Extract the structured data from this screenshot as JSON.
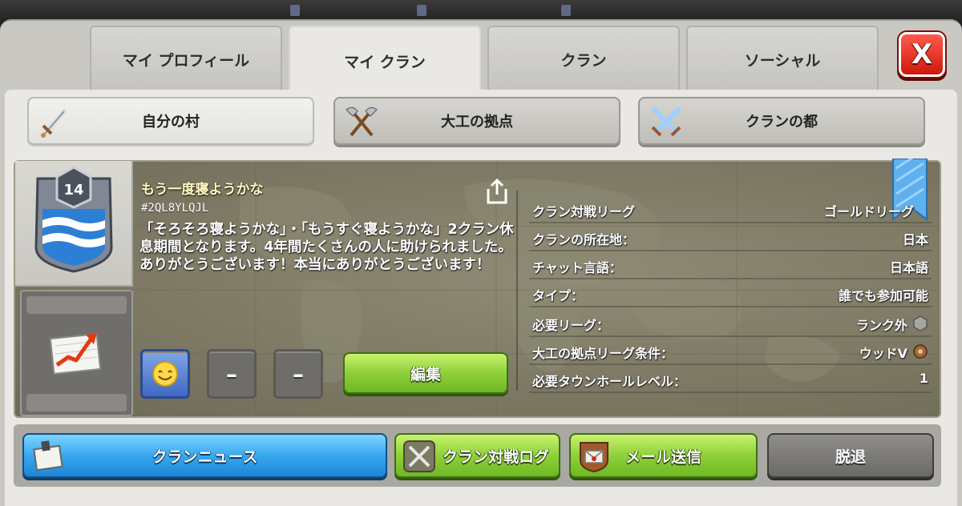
{
  "tabs": [
    {
      "label": "マイ プロフィール"
    },
    {
      "label": "マイ クラン"
    },
    {
      "label": "クラン"
    },
    {
      "label": "ソーシャル"
    }
  ],
  "close_label": "X",
  "subtabs": [
    {
      "label": "自分の村"
    },
    {
      "label": "大工の拠点"
    },
    {
      "label": "クランの都"
    }
  ],
  "clan": {
    "level": "14",
    "name": "もう一度寝ようかな",
    "tag": "#2QL8YLQJL",
    "description": "「そろそろ寝ようかな」・「もうすぐ寝ようかな」2クラン休息期間となります。4年間たくさんの人に助けられました。ありがとうございます！本当にありがとうございます！"
  },
  "info": [
    {
      "key": "クラン対戦リーグ",
      "value": "ゴールドリーグ"
    },
    {
      "key": "クランの所在地：",
      "value": "日本"
    },
    {
      "key": "チャット言語：",
      "value": "日本語"
    },
    {
      "key": "タイプ：",
      "value": "誰でも参加可能"
    },
    {
      "key": "必要リーグ：",
      "value": "ランク外"
    },
    {
      "key": "大工の拠点リーグ条件：",
      "value": "ウッドV"
    },
    {
      "key": "必要タウンホールレベル：",
      "value": "1"
    }
  ],
  "actions": {
    "dash1": "–",
    "dash2": "–",
    "edit": "編集"
  },
  "bottom": {
    "news": "クランニュース",
    "war_log": "クラン対戦ログ",
    "mail": "メール送信",
    "leave": "脱退"
  },
  "colors": {
    "close_red": "#d0180d",
    "green": "#8ed03a",
    "blue": "#38a8f0",
    "panel": "#e9e8e4"
  }
}
